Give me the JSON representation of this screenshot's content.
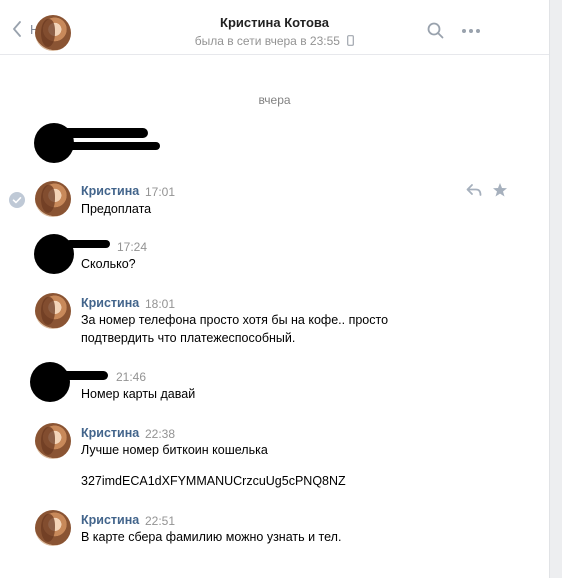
{
  "header": {
    "back_label": "Назад",
    "chat_name": "Кристина Котова",
    "status": "была в сети вчера в 23:55"
  },
  "date_separator": "вчера",
  "messages": [
    {
      "author": "Кристина",
      "time": "17:01",
      "lines": [
        "Предоплата"
      ]
    },
    {
      "author": "",
      "time": "17:24",
      "lines": [
        "Сколько?"
      ]
    },
    {
      "author": "Кристина",
      "time": "18:01",
      "lines": [
        "За номер телефона просто хотя бы на кофе.. просто",
        "подтвердить что платежеспособный."
      ]
    },
    {
      "author": "",
      "time": "21:46",
      "lines": [
        "Номер карты давай"
      ]
    },
    {
      "author": "Кристина",
      "time": "22:38",
      "lines": [
        "Лучше номер биткоин кошелька",
        "327imdECA1dXFYMMANUCrzcuUg5cPNQ8NZ"
      ]
    },
    {
      "author": "Кристина",
      "time": "22:51",
      "lines": [
        "В карте сбера фамилию можно узнать и тел."
      ]
    }
  ],
  "icons": {
    "back": "chevron-left-icon",
    "search": "search-icon",
    "more": "more-dots-icon",
    "phone": "mobile-phone-icon",
    "selected": "check-circle-icon",
    "reply": "reply-icon",
    "favorite": "star-icon"
  },
  "colors": {
    "author": "#42648b",
    "time": "#939393",
    "background": "#edeef0"
  }
}
